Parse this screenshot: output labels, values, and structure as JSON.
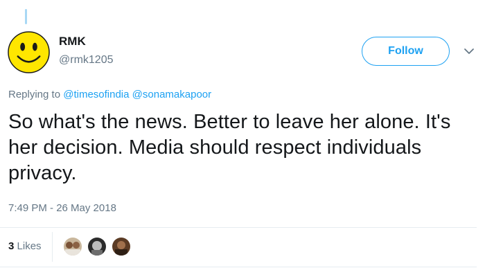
{
  "user": {
    "name": "RMK",
    "handle": "@rmk1205"
  },
  "follow_label": "Follow",
  "reply": {
    "prefix": "Replying to",
    "mentions": [
      "@timesofindia",
      "@sonamakapoor"
    ]
  },
  "tweet": {
    "text": "So what's the news. Better to leave her alone. It's her decision. Media should respect individuals privacy.",
    "timestamp": "7:49 PM - 26 May 2018"
  },
  "engagement": {
    "likes_count": "3",
    "likes_label": "Likes"
  },
  "icons": {
    "avatar": "smiley-face-icon",
    "caret": "chevron-down-icon"
  },
  "colors": {
    "accent": "#1da1f2",
    "text": "#14171a",
    "secondary": "#657786"
  }
}
